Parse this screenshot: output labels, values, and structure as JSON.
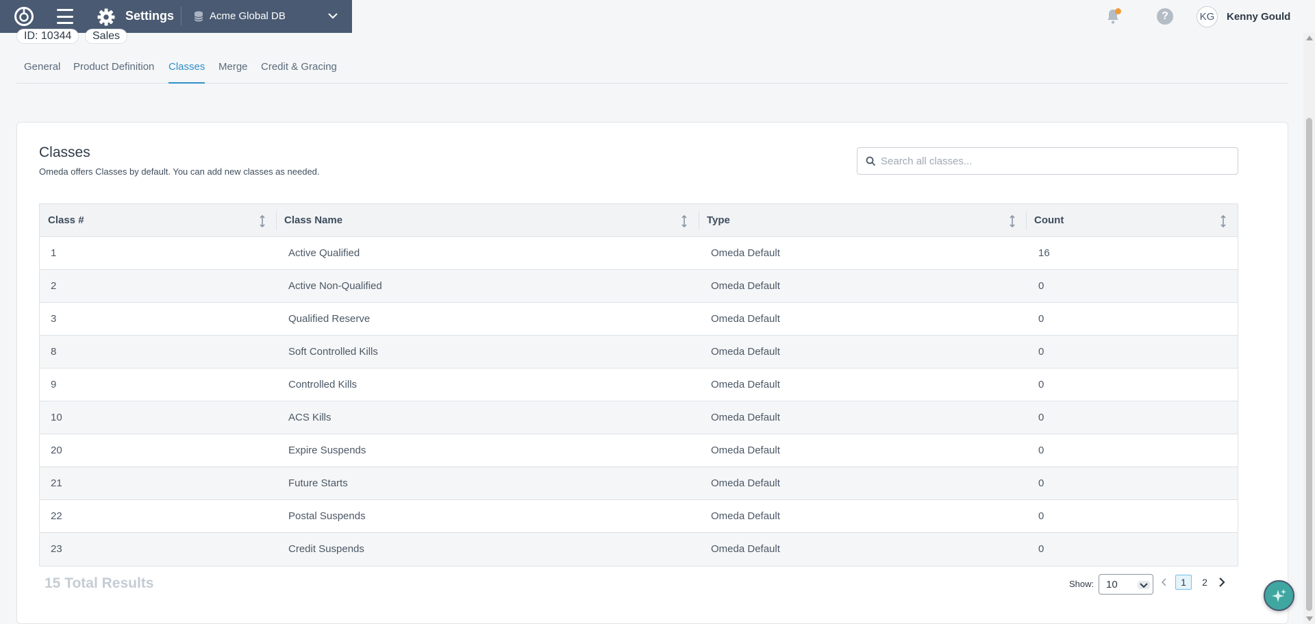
{
  "app": {
    "title": "Settings",
    "database": "Acme Global DB"
  },
  "user": {
    "initials": "KG",
    "name": "Kenny Gould"
  },
  "chips": {
    "id": "ID: 10344",
    "dept": "Sales"
  },
  "tabs": [
    "General",
    "Product Definition",
    "Classes",
    "Merge",
    "Credit & Gracing"
  ],
  "active_tab": "Classes",
  "card": {
    "title": "Classes",
    "subtitle": "Omeda offers Classes by default. You can add new classes as needed.",
    "search_placeholder": "Search all classes..."
  },
  "table": {
    "headers": [
      "Class #",
      "Class Name",
      "Type",
      "Count"
    ],
    "rows": [
      [
        "1",
        "Active Qualified",
        "Omeda Default",
        "16"
      ],
      [
        "2",
        "Active Non-Qualified",
        "Omeda Default",
        "0"
      ],
      [
        "3",
        "Qualified Reserve",
        "Omeda Default",
        "0"
      ],
      [
        "8",
        "Soft Controlled Kills",
        "Omeda Default",
        "0"
      ],
      [
        "9",
        "Controlled Kills",
        "Omeda Default",
        "0"
      ],
      [
        "10",
        "ACS Kills",
        "Omeda Default",
        "0"
      ],
      [
        "20",
        "Expire Suspends",
        "Omeda Default",
        "0"
      ],
      [
        "21",
        "Future Starts",
        "Omeda Default",
        "0"
      ],
      [
        "22",
        "Postal Suspends",
        "Omeda Default",
        "0"
      ],
      [
        "23",
        "Credit Suspends",
        "Omeda Default",
        "0"
      ]
    ]
  },
  "footer": {
    "total": "15 Total Results",
    "show_label": "Show:",
    "page_size": "10",
    "pages": [
      "1",
      "2"
    ],
    "current_page": "1"
  },
  "colors": {
    "topbar": "#4a5a72",
    "accent": "#2f8fc8",
    "notification": "#f29a38",
    "assistant": "#3fa6a0"
  },
  "icons": [
    "logo-icon",
    "menu-icon",
    "gear-icon",
    "database-icon",
    "chevron-down-icon",
    "bell-icon",
    "help-icon",
    "search-icon",
    "sort-icon",
    "chevron-left-icon",
    "chevron-right-icon",
    "sparkle-icon"
  ]
}
